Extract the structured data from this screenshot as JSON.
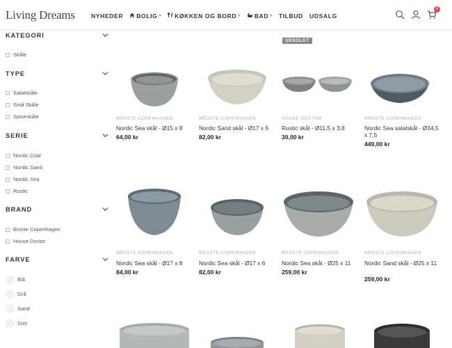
{
  "header": {
    "logo": "Living Dreams",
    "nav": [
      {
        "label": "NYHEDER",
        "icon": "",
        "has_dropdown": false
      },
      {
        "label": "BOLIG",
        "icon": "home-icon",
        "has_dropdown": true
      },
      {
        "label": "KØKKEN OG BORD",
        "icon": "cutlery-icon",
        "has_dropdown": true
      },
      {
        "label": "BAD",
        "icon": "bath-icon",
        "has_dropdown": true
      },
      {
        "label": "TILBUD",
        "icon": "",
        "has_dropdown": false
      },
      {
        "label": "UDSALG",
        "icon": "",
        "has_dropdown": false
      }
    ],
    "cart_count": "0",
    "icons": [
      "search-icon",
      "user-icon",
      "cart-icon"
    ]
  },
  "filters": [
    {
      "title": "KATEGORI",
      "options": [
        "Skåle"
      ],
      "style": "checkbox"
    },
    {
      "title": "TYPE",
      "options": [
        "Salatskåle",
        "Små Skåle",
        "Spiseskåle"
      ],
      "style": "checkbox"
    },
    {
      "title": "SERIE",
      "options": [
        "Nordic Coal",
        "Nordic Sand",
        "Nordic Sea",
        "Rustic"
      ],
      "style": "checkbox"
    },
    {
      "title": "BRAND",
      "options": [
        "Broste Copenhagen",
        "House Doctor"
      ],
      "style": "checkbox"
    },
    {
      "title": "FARVE",
      "options": [
        "Blå",
        "Grå",
        "Sand",
        "Sort"
      ],
      "style": "swatch"
    }
  ],
  "products": [
    {
      "brand": "BROSTE COPENHAGEN",
      "name": "Nordic Sea skål - Ø15 x 8",
      "price": "64,00 kr",
      "badge": ""
    },
    {
      "brand": "BROSTE COPENHAGEN",
      "name": "Nordic Sand skål - Ø17 x 6",
      "price": "82,00 kr",
      "badge": ""
    },
    {
      "brand": "HOUSE DOCTOR",
      "name": "Rustic skål - Ø11,5 x 3,8",
      "price": "30,00 kr",
      "badge": "UDSOLGT"
    },
    {
      "brand": "BROSTE COPENHAGEN",
      "name": "Nordic Sea salatskål - Ø34,5 x 7,5",
      "price": "449,00 kr",
      "badge": ""
    },
    {
      "brand": "BROSTE COPENHAGEN",
      "name": "Nordic Sea skål - Ø17 x 8",
      "price": "84,00 kr",
      "badge": ""
    },
    {
      "brand": "BROSTE COPENHAGEN",
      "name": "Nordic Sea skål - Ø17 x 6",
      "price": "82,00 kr",
      "badge": ""
    },
    {
      "brand": "BROSTE COPENHAGEN",
      "name": "Nordic Sea skål - Ø25 x 11",
      "price": "259,00 kr",
      "badge": ""
    },
    {
      "brand": "BROSTE COPENHAGEN",
      "name": "Nordic Sand skål - Ø25 x 11",
      "price": "259,00 kr",
      "badge": ""
    }
  ]
}
